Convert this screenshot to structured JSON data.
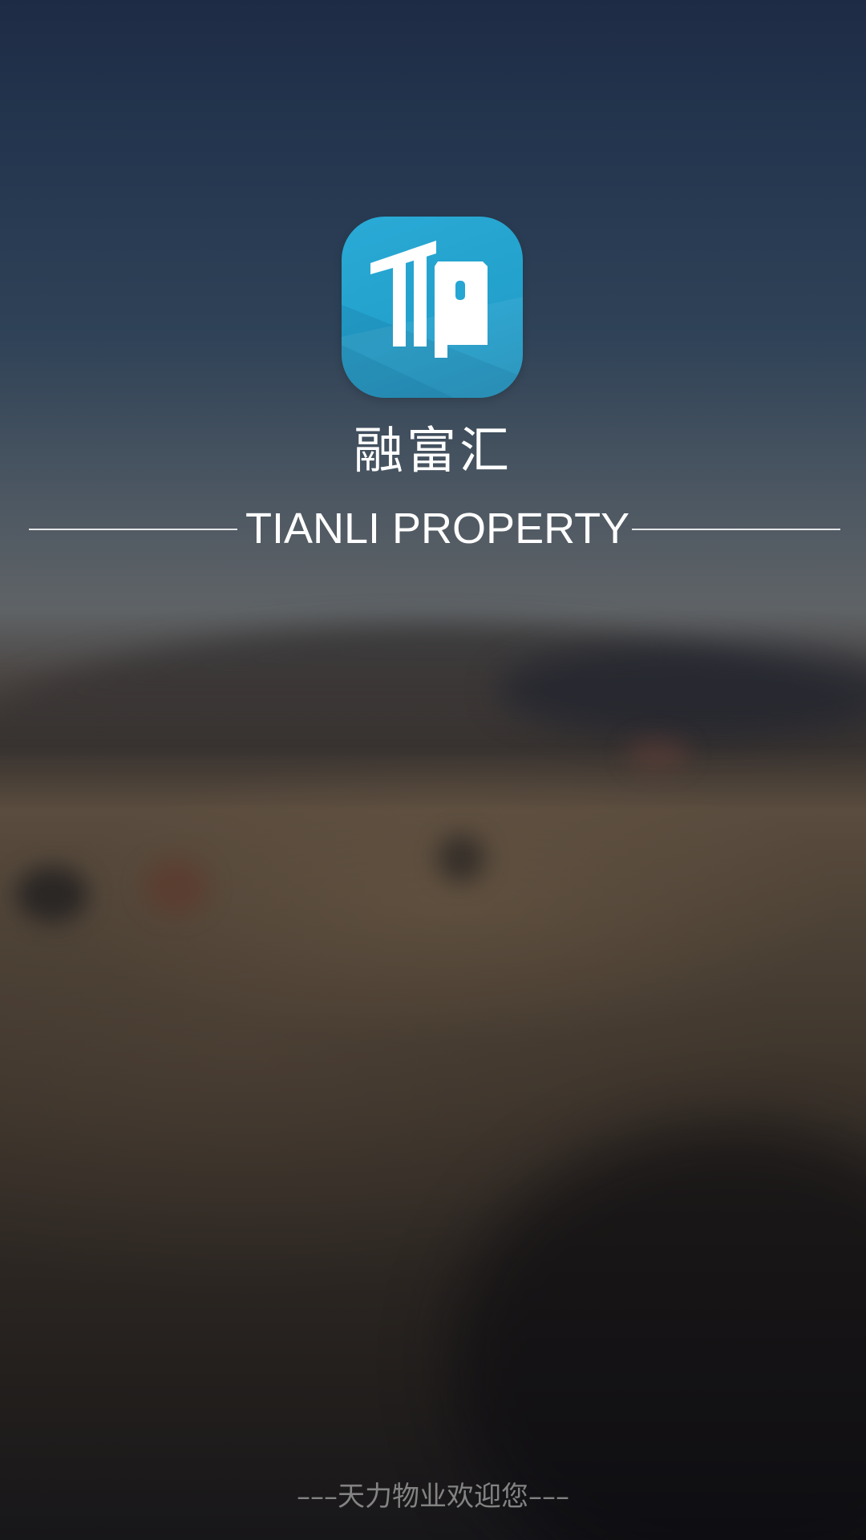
{
  "splash": {
    "logo_icon": "tianli-property-logo-icon",
    "app_name": "融富汇",
    "tagline": "TIANLI PROPERTY",
    "welcome": "–––天力物业欢迎您–––"
  },
  "colors": {
    "icon_background": "#25a6d3",
    "text_primary": "#ffffff",
    "text_footer": "#969696"
  }
}
